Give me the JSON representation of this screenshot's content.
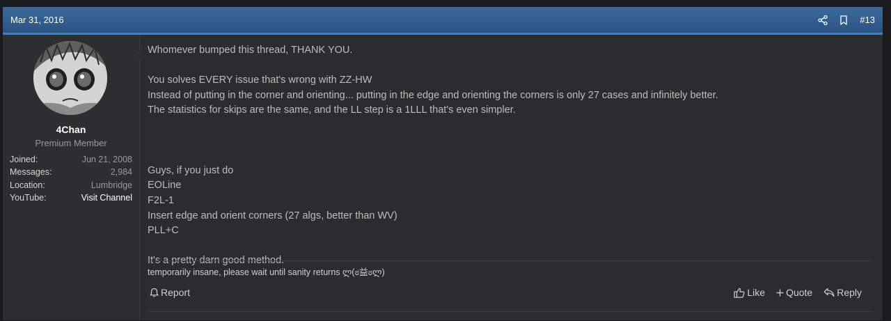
{
  "post": {
    "date": "Mar 31, 2016",
    "number": "#13",
    "header_icons": [
      "share-icon",
      "bookmark-icon"
    ]
  },
  "user": {
    "name": "4Chan",
    "title": "Premium Member",
    "stats": [
      {
        "label": "Joined:",
        "value": "Jun 21, 2008"
      },
      {
        "label": "Messages:",
        "value": "2,984"
      },
      {
        "label": "Location:",
        "value": "Lumbridge"
      },
      {
        "label": "YouTube:",
        "value": "Visit Channel"
      }
    ]
  },
  "message": {
    "lines": [
      "Whomever bumped this thread, THANK YOU.",
      "",
      "You solves EVERY issue that's wrong with ZZ-HW",
      "Instead of putting in the corner and orienting... putting in the edge and orienting the corners is only 27 cases and infinitely better.",
      "The statistics for skips are the same, and the LL step is a 1LLL that's even simpler.",
      "",
      "",
      "",
      "Guys, if you just do",
      "EOLine",
      "F2L-1",
      "Insert edge and orient corners (27 algs, better than WV)",
      "PLL+C",
      "",
      "It's a pretty darn good method."
    ]
  },
  "signature": "temporarily insane, please wait until sanity returns ლ(ಠ益ಠლ)",
  "footer": {
    "report": "Report",
    "like": "Like",
    "quote": "Quote",
    "reply": "Reply"
  },
  "colors": {
    "header_bg": "#2f5b8c",
    "header_border": "#3b83c9",
    "post_bg": "#2b2c2e",
    "page_bg": "#1b1c1e"
  }
}
